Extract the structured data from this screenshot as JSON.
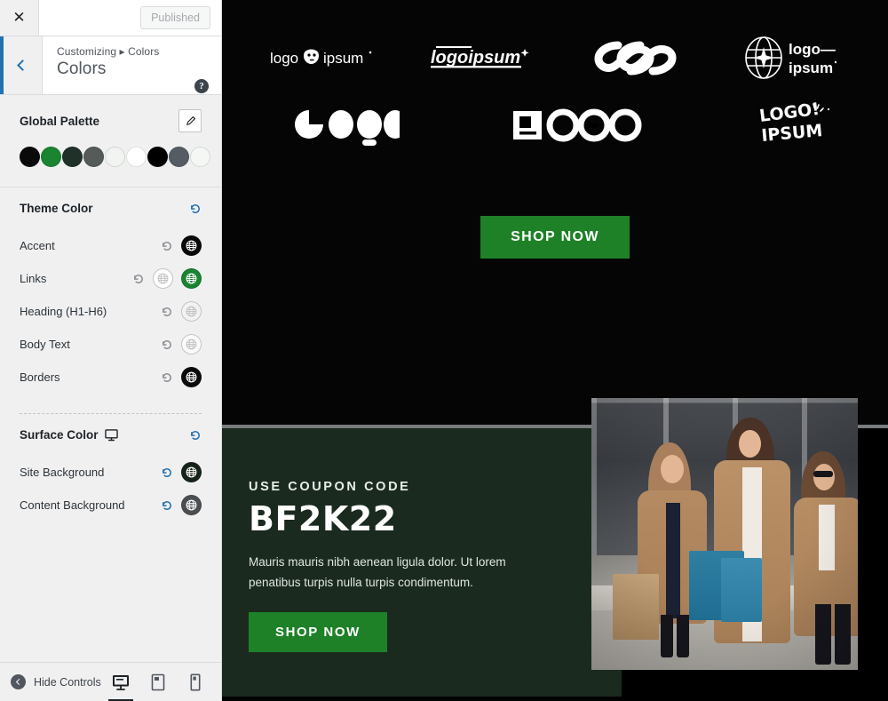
{
  "customizer": {
    "close_label": "✕",
    "publish_button": "Published",
    "breadcrumb": "Customizing ▸ Colors",
    "panel_title": "Colors",
    "help_label": "?",
    "back_label": "Back",
    "palette": {
      "title": "Global Palette",
      "edit_label": "Edit",
      "swatches": [
        {
          "name": "palette-swatch-1",
          "color": "#0a0a0a"
        },
        {
          "name": "palette-swatch-2",
          "color": "#1a8431"
        },
        {
          "name": "palette-swatch-3",
          "color": "#1f3129"
        },
        {
          "name": "palette-swatch-4",
          "color": "#555b58"
        },
        {
          "name": "palette-swatch-5",
          "color": "#f2f4f2"
        },
        {
          "name": "palette-swatch-6",
          "color": "#ffffff"
        },
        {
          "name": "palette-swatch-7",
          "color": "#000000"
        },
        {
          "name": "palette-swatch-8",
          "color": "#555c63"
        },
        {
          "name": "palette-swatch-9",
          "color": "#f5f7f5"
        }
      ]
    },
    "theme_color": {
      "title": "Theme Color",
      "reset_title": "Reset",
      "rows": [
        {
          "label": "Accent",
          "color": "#0a0a0a",
          "light": false,
          "extra": false,
          "reset_blue": false
        },
        {
          "label": "Links",
          "color": "#1a8431",
          "light": false,
          "extra": true,
          "reset_blue": false
        },
        {
          "label": "Heading (H1-H6)",
          "color": "#f1f2f1",
          "light": true,
          "extra": false,
          "reset_blue": false
        },
        {
          "label": "Body Text",
          "color": "#fbfbfb",
          "light": true,
          "extra": false,
          "reset_blue": false
        },
        {
          "label": "Borders",
          "color": "#0a0a0a",
          "light": false,
          "extra": false,
          "reset_blue": false
        }
      ]
    },
    "surface_color": {
      "title": "Surface Color",
      "device_icon": "monitor-icon",
      "reset_title": "Reset",
      "rows": [
        {
          "label": "Site Background",
          "color": "#16231b",
          "light": false,
          "reset_blue": true
        },
        {
          "label": "Content Background",
          "color": "#4c4f52",
          "light": false,
          "reset_blue": true
        }
      ]
    },
    "footer": {
      "hide_controls": "Hide Controls",
      "devices": [
        {
          "name": "device-desktop",
          "label": "Desktop",
          "active": true
        },
        {
          "name": "device-tablet",
          "label": "Tablet",
          "active": false
        },
        {
          "name": "device-mobile",
          "label": "Mobile",
          "active": false
        }
      ]
    }
  },
  "preview": {
    "logos_row1": [
      {
        "name": "logo-bear-ipsum",
        "text": "logo ipsum"
      },
      {
        "name": "logo-logoipsum-italic",
        "text": "logoipsum+"
      },
      {
        "name": "logo-chain-loops",
        "text": ""
      },
      {
        "name": "logo-globe-ipsum",
        "text": "logo— ipsum"
      }
    ],
    "logos_row2": [
      {
        "name": "logo-bold-rounded",
        "text": "LOGO"
      },
      {
        "name": "logo-square-l",
        "text": "LOGO"
      },
      {
        "name": "logo-handwritten",
        "text": "LOGO! IPSUM"
      }
    ],
    "hero_cta": "SHOP NOW",
    "coupon": {
      "kicker": "USE COUPON CODE",
      "code": "BF2K22",
      "body": "Mauris mauris nibh aenean ligula dolor. Ut lorem penatibus turpis nulla turpis condimentum.",
      "cta": "SHOP NOW"
    },
    "photo_alt": "Three women in camel coats walking with shopping bags"
  },
  "colors": {
    "accent_blue": "#2271b1",
    "green_button": "#1e8127",
    "coupon_bg": "#1a2a1f",
    "site_bg": "#050505",
    "preview_frame": "#797c7e"
  }
}
